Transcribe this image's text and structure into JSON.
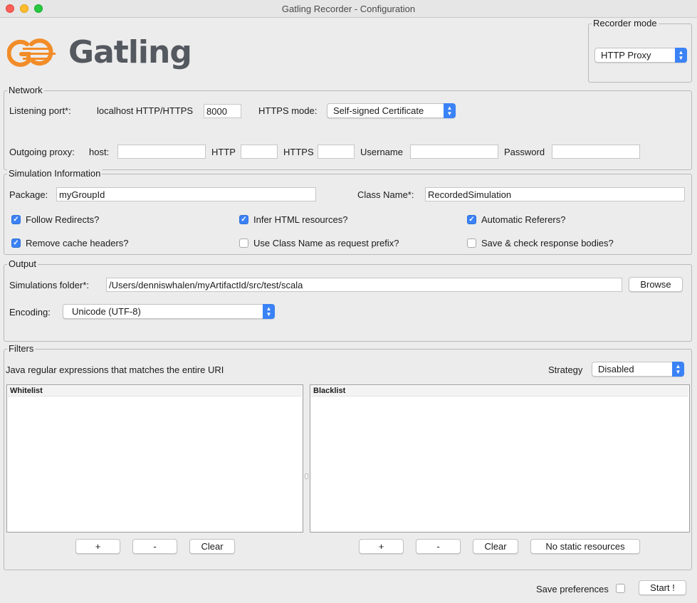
{
  "window": {
    "title": "Gatling Recorder - Configuration"
  },
  "logo": {
    "text": "Gatling",
    "accent_color": "#f28c28",
    "text_color": "#54585f"
  },
  "recorder_mode": {
    "legend": "Recorder mode",
    "selected": "HTTP Proxy"
  },
  "network": {
    "legend": "Network",
    "listening_port_label": "Listening port*:",
    "localhost_label": "localhost HTTP/HTTPS",
    "port_value": "8000",
    "https_mode_label": "HTTPS mode:",
    "https_mode_selected": "Self-signed Certificate",
    "outgoing_proxy_label": "Outgoing proxy:",
    "host_label": "host:",
    "host_value": "",
    "http_label": "HTTP",
    "http_value": "",
    "https_label": "HTTPS",
    "https_value": "",
    "username_label": "Username",
    "username_value": "",
    "password_label": "Password",
    "password_value": ""
  },
  "simulation": {
    "legend": "Simulation Information",
    "package_label": "Package:",
    "package_value": "myGroupId",
    "class_name_label": "Class Name*:",
    "class_name_value": "RecordedSimulation",
    "checkboxes": [
      {
        "label": "Follow Redirects?",
        "checked": true
      },
      {
        "label": "Infer HTML resources?",
        "checked": true
      },
      {
        "label": "Automatic Referers?",
        "checked": true
      },
      {
        "label": "Remove cache headers?",
        "checked": true
      },
      {
        "label": "Use Class Name as request prefix?",
        "checked": false
      },
      {
        "label": "Save & check response bodies?",
        "checked": false
      }
    ]
  },
  "output": {
    "legend": "Output",
    "folder_label": "Simulations folder*:",
    "folder_value": "/Users/denniswhalen/myArtifactId/src/test/scala",
    "browse_label": "Browse",
    "encoding_label": "Encoding:",
    "encoding_selected": "Unicode (UTF-8)"
  },
  "filters": {
    "legend": "Filters",
    "description": "Java regular expressions that matches the entire URI",
    "strategy_label": "Strategy",
    "strategy_selected": "Disabled",
    "whitelist_header": "Whitelist",
    "blacklist_header": "Blacklist",
    "add_label": "+",
    "remove_label": "-",
    "clear_label": "Clear",
    "no_static_label": "No static resources"
  },
  "footer": {
    "save_preferences_label": "Save preferences",
    "save_preferences_checked": false,
    "start_label": "Start !"
  },
  "colors": {
    "accent": "#3b82f6",
    "window_bg": "#ececec"
  }
}
